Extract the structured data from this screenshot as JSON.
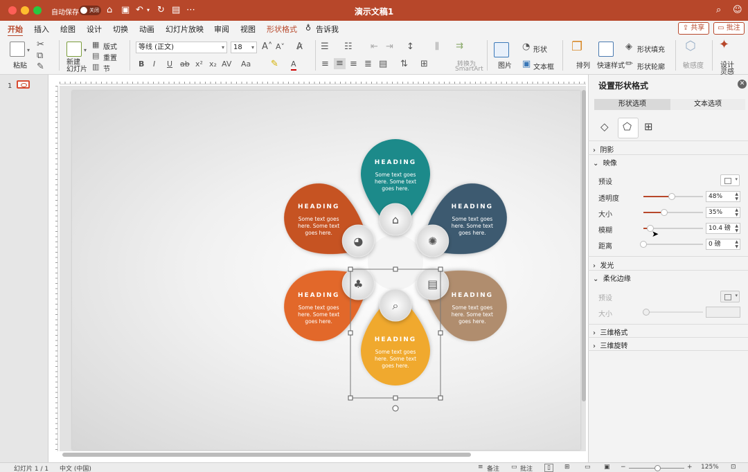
{
  "window": {
    "title": "演示文稿1",
    "autosave_label": "自动保存",
    "autosave_state": "关闭"
  },
  "tabs": [
    "开始",
    "插入",
    "绘图",
    "设计",
    "切换",
    "动画",
    "幻灯片放映",
    "审阅",
    "视图",
    "形状格式",
    "告诉我"
  ],
  "header_buttons": {
    "share": "共享",
    "comment": "批注"
  },
  "ribbon": {
    "paste": "粘贴",
    "new_slide": "新建\n幻灯片",
    "layout": "版式",
    "reset": "重置",
    "section": "节",
    "font_name": "等线 (正文)",
    "font_size": "18",
    "convert_smartart_1": "转换为",
    "convert_smartart_2": "SmartArt",
    "picture": "图片",
    "shape": "形状",
    "textbox": "文本框",
    "arrange": "排列",
    "quick_styles": "快速样式",
    "shape_fill": "形状填充",
    "shape_outline": "形状轮廓",
    "sensitivity": "敏感度",
    "designer_1": "设计",
    "designer_2": "灵感"
  },
  "thumbnails": {
    "slide_number": "1"
  },
  "slide": {
    "petals": [
      {
        "heading": "HEADING",
        "line1": "Some text goes",
        "line2": "here. Some text",
        "line3": "goes here.",
        "color": "#1a8a8a"
      },
      {
        "heading": "HEADING",
        "line1": "Some text goes",
        "line2": "here. Some text",
        "line3": "goes here.",
        "color": "#3d5a70"
      },
      {
        "heading": "HEADING",
        "line1": "Some text goes",
        "line2": "here. Some text",
        "line3": "goes here.",
        "color": "#b08d6e"
      },
      {
        "heading": "HEADING",
        "line1": "Some text goes",
        "line2": "here. Some text",
        "line3": "goes here.",
        "color": "#f0a92d"
      },
      {
        "heading": "HEADING",
        "line1": "Some text goes",
        "line2": "here. Some text",
        "line3": "goes here.",
        "color": "#e2672c"
      },
      {
        "heading": "HEADING",
        "line1": "Some text goes",
        "line2": "here. Some text",
        "line3": "goes here.",
        "color": "#c65324"
      }
    ]
  },
  "format_pane": {
    "title": "设置形状格式",
    "tabs": [
      "形状选项",
      "文本选项"
    ],
    "sections": {
      "shadow": "阴影",
      "reflection": "映像",
      "glow": "发光",
      "soft_edges": "柔化边缘",
      "three_d_format": "三维格式",
      "three_d_rotation": "三维旋转"
    },
    "reflection": {
      "preset_label": "预设",
      "transparency_label": "透明度",
      "transparency_value": "48%",
      "transparency_fraction": 0.48,
      "size_label": "大小",
      "size_value": "35%",
      "size_fraction": 0.35,
      "blur_label": "模糊",
      "blur_value": "10.4 磅",
      "blur_fraction": 0.12,
      "distance_label": "距离",
      "distance_value": "0 磅",
      "distance_fraction": 0
    },
    "soft_edges": {
      "preset_label": "预设",
      "size_label": "大小"
    }
  },
  "status_bar": {
    "slide_info": "幻灯片 1 / 1",
    "language": "中文 (中国)",
    "notes": "备注",
    "comments": "批注",
    "zoom": "125%"
  },
  "colors": {
    "accent": "#b7472a"
  }
}
